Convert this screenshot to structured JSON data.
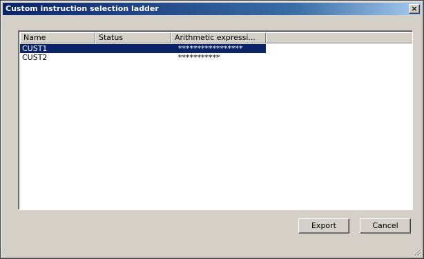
{
  "window": {
    "title": "Custom instruction selection ladder",
    "close_glyph": "×"
  },
  "list": {
    "columns": [
      "Name",
      "Status",
      "Arithmetic expressi..."
    ],
    "rows": [
      {
        "name": "CUST1",
        "status": "",
        "expression": "*****************",
        "selected": true
      },
      {
        "name": "CUST2",
        "status": "",
        "expression": "***********",
        "selected": false
      }
    ]
  },
  "buttons": {
    "export_label": "Export",
    "cancel_label": "Cancel"
  },
  "colors": {
    "selection": "#0a246a",
    "face": "#d4d0c8"
  }
}
